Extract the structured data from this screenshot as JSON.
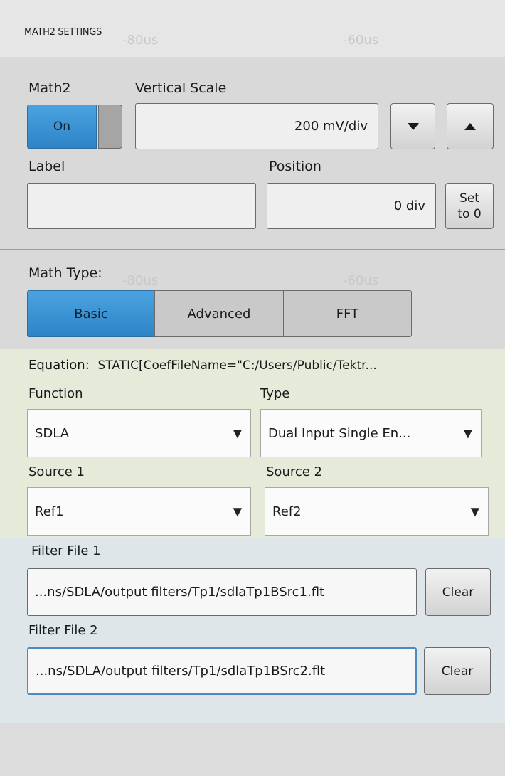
{
  "header": {
    "title": "MATH2 SETTINGS"
  },
  "background_grid": {
    "left_time": "-80us",
    "right_time": "-60us"
  },
  "math": {
    "label": "Math2",
    "toggle_label": "On",
    "toggle_state": "on"
  },
  "vertical_scale": {
    "label": "Vertical Scale",
    "value": "200 mV/div",
    "down_icon": "triangle-down-icon",
    "up_icon": "triangle-up-icon"
  },
  "label_field": {
    "label": "Label",
    "value": ""
  },
  "position": {
    "label": "Position",
    "value": "0 div",
    "set_to_zero_line1": "Set",
    "set_to_zero_line2": "to 0"
  },
  "math_type": {
    "label": "Math Type:",
    "options": [
      "Basic",
      "Advanced",
      "FFT"
    ],
    "selected": "Basic"
  },
  "equation": {
    "label": "Equation:",
    "value": "STATIC[CoefFileName=\"C:/Users/Public/Tektr..."
  },
  "function": {
    "label": "Function",
    "value": "SDLA"
  },
  "type": {
    "label": "Type",
    "value": "Dual Input Single En..."
  },
  "source1": {
    "label": "Source 1",
    "value": "Ref1"
  },
  "source2": {
    "label": "Source 2",
    "value": "Ref2"
  },
  "filter1": {
    "label": "Filter File 1",
    "value": "...ns/SDLA/output filters/Tp1/sdlaTp1BSrc1.flt",
    "clear_label": "Clear"
  },
  "filter2": {
    "label": "Filter File 2",
    "value": "...ns/SDLA/output filters/Tp1/sdlaTp1BSrc2.flt",
    "clear_label": "Clear"
  },
  "colors": {
    "accent": "#3a93d4",
    "green_bg": "#e6ead9",
    "blue_bg": "#dfe6ea"
  }
}
